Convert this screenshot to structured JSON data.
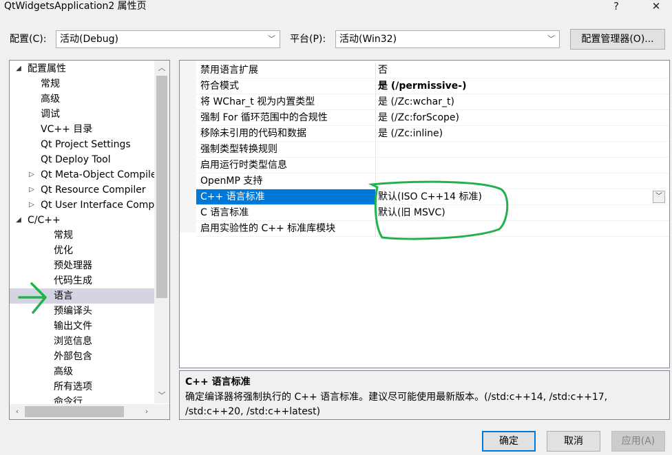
{
  "window": {
    "title": "QtWidgetsApplication2 属性页",
    "help_glyph": "?",
    "close_glyph": "✕"
  },
  "toolbar": {
    "config_label": "配置(C):",
    "config_value": "活动(Debug)",
    "platform_label": "平台(P):",
    "platform_value": "活动(Win32)",
    "config_manager_label": "配置管理器(O)..."
  },
  "tree": {
    "items": [
      {
        "label": "配置属性",
        "expander": "◢"
      },
      {
        "label": "常规"
      },
      {
        "label": "高级"
      },
      {
        "label": "调试"
      },
      {
        "label": "VC++ 目录"
      },
      {
        "label": "Qt Project Settings"
      },
      {
        "label": "Qt Deploy Tool"
      },
      {
        "label": "Qt Meta-Object Compiler",
        "expander": "▷"
      },
      {
        "label": "Qt Resource Compiler",
        "expander": "▷"
      },
      {
        "label": "Qt User Interface Compiler",
        "expander": "▷"
      },
      {
        "label": "C/C++",
        "expander": "◢"
      },
      {
        "label": "常规"
      },
      {
        "label": "优化"
      },
      {
        "label": "预处理器"
      },
      {
        "label": "代码生成"
      },
      {
        "label": "语言"
      },
      {
        "label": "预编译头"
      },
      {
        "label": "输出文件"
      },
      {
        "label": "浏览信息"
      },
      {
        "label": "外部包含"
      },
      {
        "label": "高级"
      },
      {
        "label": "所有选项"
      },
      {
        "label": "命令行"
      }
    ]
  },
  "grid": {
    "rows": [
      {
        "name": "禁用语言扩展",
        "value": "否"
      },
      {
        "name": "符合模式",
        "value": "是 (/permissive-)"
      },
      {
        "name": "将 WChar_t 视为内置类型",
        "value": "是 (/Zc:wchar_t)"
      },
      {
        "name": "强制 For 循环范围中的合规性",
        "value": "是 (/Zc:forScope)"
      },
      {
        "name": "移除未引用的代码和数据",
        "value": "是 (/Zc:inline)"
      },
      {
        "name": "强制类型转换规则",
        "value": ""
      },
      {
        "name": "启用运行时类型信息",
        "value": ""
      },
      {
        "name": "OpenMP 支持",
        "value": ""
      },
      {
        "name": "C++ 语言标准",
        "value": "默认(ISO C++14 标准)"
      },
      {
        "name": "C 语言标准",
        "value": "默认(旧 MSVC)"
      },
      {
        "name": "启用实验性的 C++ 标准库模块",
        "value": ""
      }
    ]
  },
  "description": {
    "title": "C++ 语言标准",
    "text": "确定编译器将强制执行的 C++ 语言标准。建议尽可能使用最新版本。(/std:c++14, /std:c++17, /std:c++20, /std:c++latest)"
  },
  "buttons": {
    "ok": "确定",
    "cancel": "取消",
    "apply": "应用(A)"
  },
  "colors": {
    "selection": "#0078d7",
    "annotation": "#22b14c"
  }
}
